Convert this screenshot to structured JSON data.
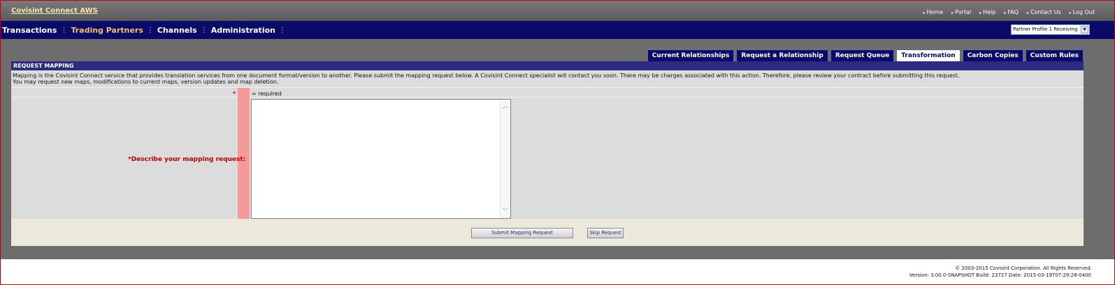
{
  "header": {
    "brand": "Covisint Connect AWS",
    "links": [
      {
        "label": "Home"
      },
      {
        "label": "Portal"
      },
      {
        "label": "Help"
      },
      {
        "label": "FAQ"
      },
      {
        "label": "Contact Us"
      },
      {
        "label": "Log Out"
      }
    ]
  },
  "nav": {
    "items": [
      {
        "label": "Transactions",
        "active": false
      },
      {
        "label": "Trading Partners",
        "active": true
      },
      {
        "label": "Channels",
        "active": false
      },
      {
        "label": "Administration",
        "active": false
      }
    ],
    "separator": "⋮",
    "profile_select": "Partner Profile 1 Receiving"
  },
  "tabs": [
    {
      "label": "Current Relationships",
      "active": false
    },
    {
      "label": "Request a Relationship",
      "active": false
    },
    {
      "label": "Request Queue",
      "active": false
    },
    {
      "label": "Transformation",
      "active": true
    },
    {
      "label": "Carbon Copies",
      "active": false
    },
    {
      "label": "Custom Rules",
      "active": false
    }
  ],
  "panel": {
    "title": "REQUEST MAPPING",
    "description_line1": "Mapping is the Covisint Connect service that provides translation services from one document format/version to another. Please submit the mapping request below. A Covisint Connect specialist will contact you soon. There may be charges associated with this action. Therefore, please review your contract before submitting this request.",
    "description_line2": "You may request new maps, modifications to current maps, version updates and map deletion.",
    "required_star": "*",
    "required_text": "= required",
    "field_label": "*Describe your mapping request:",
    "field_value": ""
  },
  "buttons": {
    "submit": "Submit Mapping Request",
    "skip": "Skip Request"
  },
  "footer": {
    "copyright": "© 2003-2015 Covisint Corporation. All Rights Reserved.",
    "version": "Version:  3.00.0-SNAPSHOT   Build:  23727   Date:  2015-03-19T07:29:28-0400"
  },
  "colors": {
    "nav_bg": "#0a0a6a",
    "active_nav": "#f3c070",
    "required_red": "#c00000",
    "required_column": "#f49a9a"
  }
}
